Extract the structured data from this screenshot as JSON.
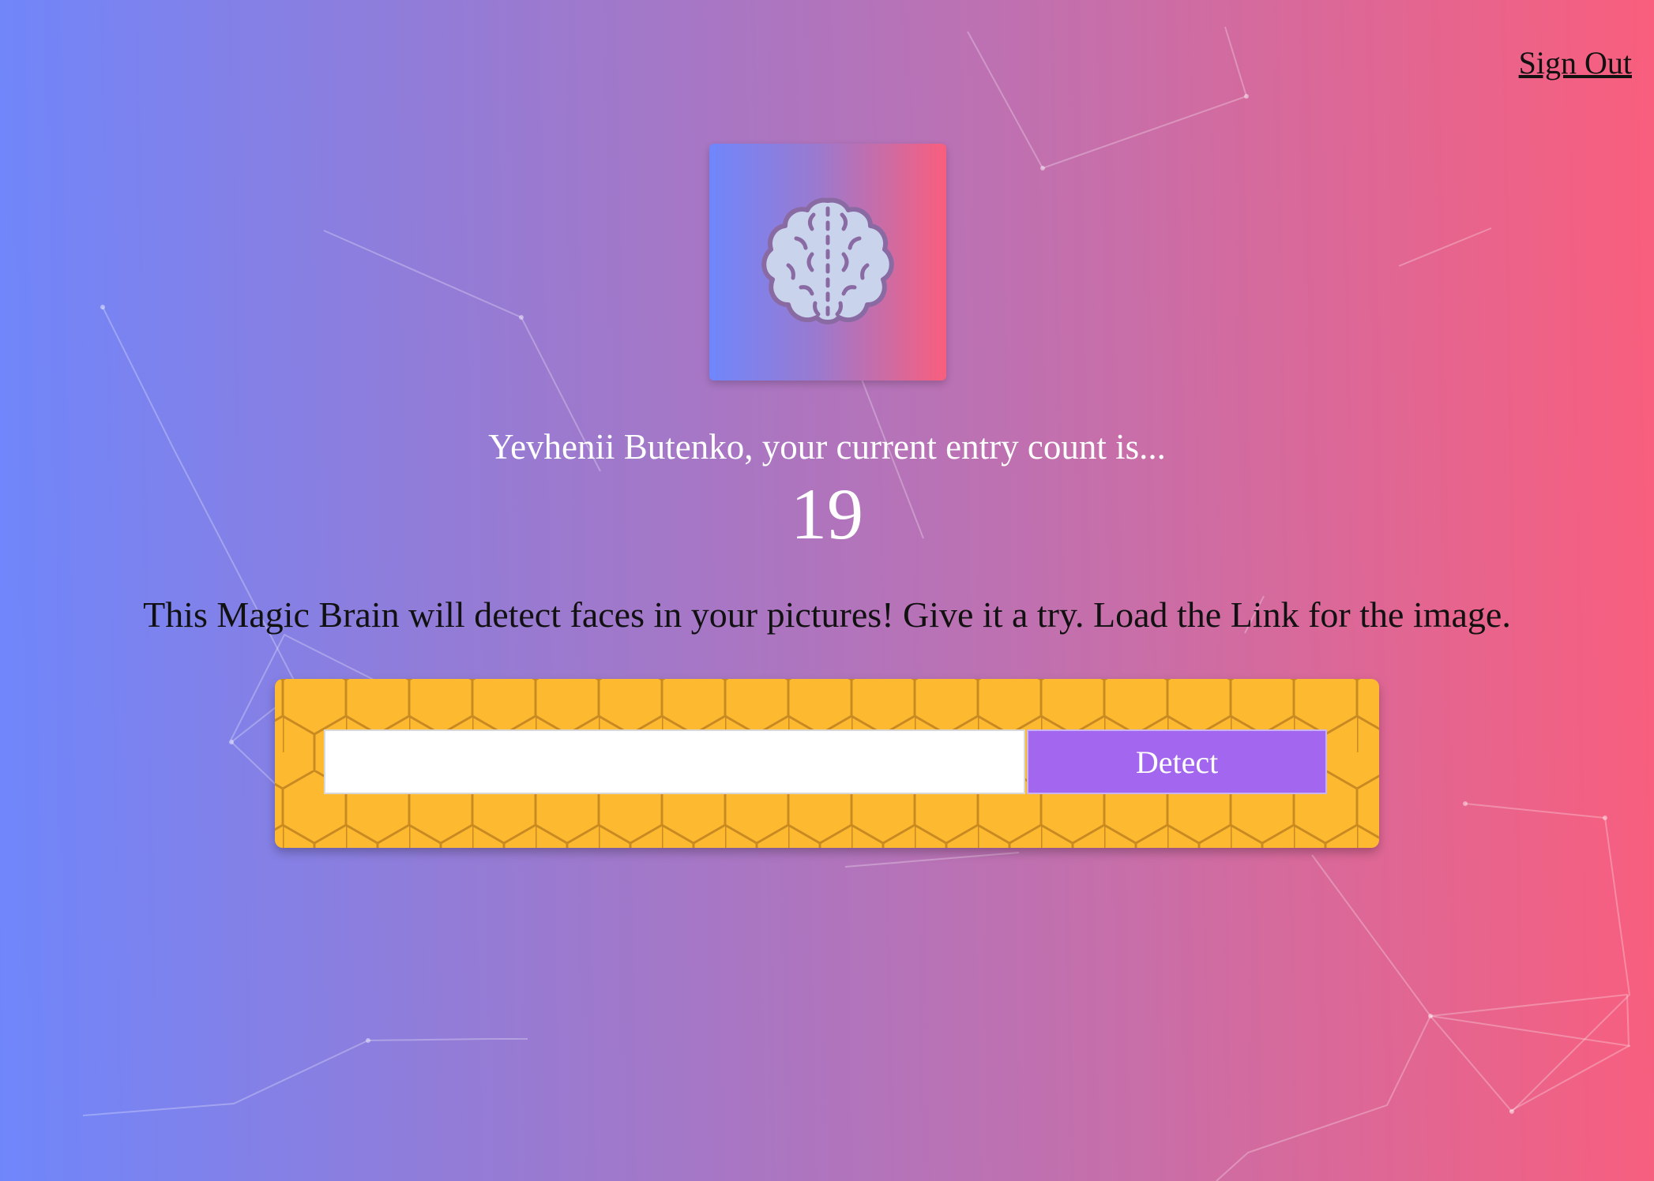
{
  "nav": {
    "sign_out_label": "Sign Out"
  },
  "logo": {
    "icon": "brain-icon"
  },
  "rank": {
    "message": "Yevhenii Butenko, your current entry count is...",
    "count": "19"
  },
  "intro": {
    "text": "This Magic Brain will detect faces in your pictures! Give it a try. Load the Link for the image."
  },
  "image_form": {
    "url_value": "",
    "detect_label": "Detect"
  },
  "colors": {
    "gradient_left": "#6f86fb",
    "gradient_right": "#f95e7d",
    "panel": "#fdba31",
    "button": "#a366ee"
  }
}
